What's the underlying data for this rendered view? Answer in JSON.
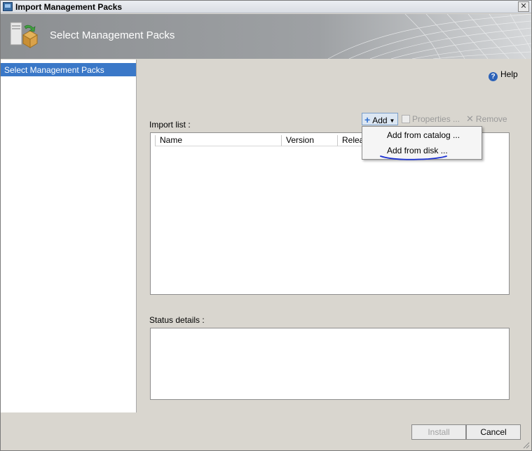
{
  "window": {
    "title": "Import Management Packs",
    "close_label": "✕"
  },
  "header": {
    "title": "Select Management Packs"
  },
  "sidebar": {
    "items": [
      {
        "label": "Select Management Packs",
        "selected": true
      }
    ]
  },
  "help": {
    "label": "Help",
    "icon": "?"
  },
  "import_list": {
    "label": "Import list :",
    "columns": [
      "Name",
      "Version",
      "Relea"
    ]
  },
  "toolbar": {
    "add_label": "Add",
    "properties_label": "Properties ...",
    "remove_label": "Remove"
  },
  "add_menu": {
    "items": [
      "Add from catalog ...",
      "Add from disk ..."
    ]
  },
  "status": {
    "label": "Status details :"
  },
  "buttons": {
    "install_label": "Install",
    "cancel_label": "Cancel"
  },
  "colors": {
    "accent": "#3a78c8",
    "pen_mark": "#1a2fd0"
  }
}
